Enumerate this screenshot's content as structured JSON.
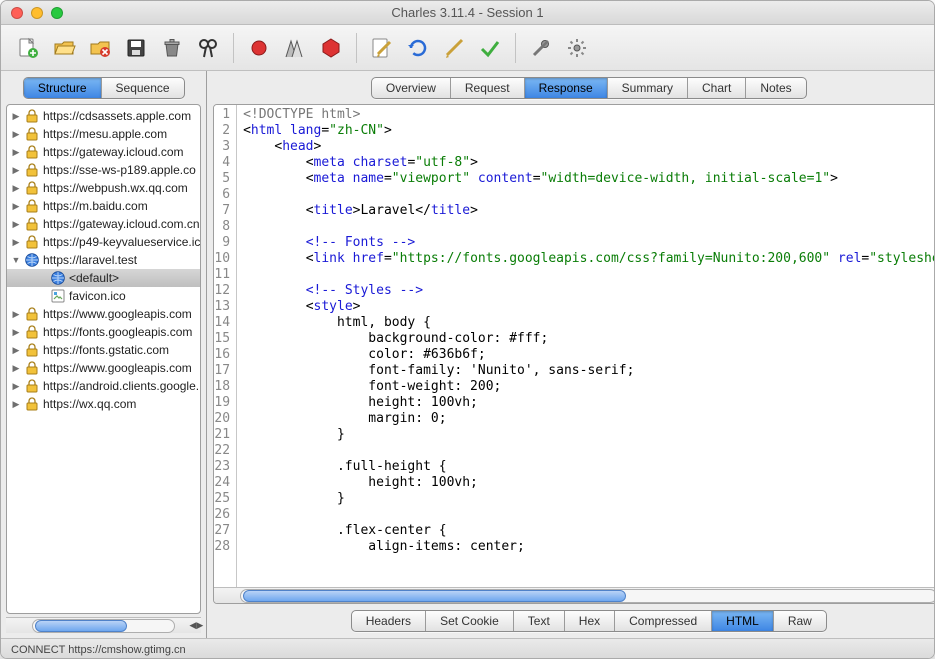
{
  "window": {
    "title": "Charles 3.11.4 - Session 1"
  },
  "left_tabs": {
    "structure": "Structure",
    "sequence": "Sequence",
    "active": "structure"
  },
  "tree": [
    {
      "expand": "closed",
      "icon": "lock",
      "label": "https://cdsassets.apple.com"
    },
    {
      "expand": "closed",
      "icon": "lock",
      "label": "https://mesu.apple.com"
    },
    {
      "expand": "closed",
      "icon": "lock",
      "label": "https://gateway.icloud.com"
    },
    {
      "expand": "closed",
      "icon": "lock",
      "label": "https://sse-ws-p189.apple.co"
    },
    {
      "expand": "closed",
      "icon": "lock",
      "label": "https://webpush.wx.qq.com"
    },
    {
      "expand": "closed",
      "icon": "lock",
      "label": "https://m.baidu.com"
    },
    {
      "expand": "closed",
      "icon": "lock",
      "label": "https://gateway.icloud.com.cn"
    },
    {
      "expand": "closed",
      "icon": "lock",
      "label": "https://p49-keyvalueservice.ic"
    },
    {
      "expand": "open",
      "icon": "globe",
      "label": "https://laravel.test",
      "children": [
        {
          "icon": "globe",
          "label": "<default>",
          "selected": true
        },
        {
          "icon": "file",
          "label": "favicon.ico"
        }
      ]
    },
    {
      "expand": "closed",
      "icon": "lock",
      "label": "https://www.googleapis.com"
    },
    {
      "expand": "closed",
      "icon": "lock",
      "label": "https://fonts.googleapis.com"
    },
    {
      "expand": "closed",
      "icon": "lock",
      "label": "https://fonts.gstatic.com"
    },
    {
      "expand": "closed",
      "icon": "lock",
      "label": "https://www.googleapis.com"
    },
    {
      "expand": "closed",
      "icon": "lock",
      "label": "https://android.clients.google."
    },
    {
      "expand": "closed",
      "icon": "lock",
      "label": "https://wx.qq.com"
    }
  ],
  "top_tabs": {
    "items": [
      "Overview",
      "Request",
      "Response",
      "Summary",
      "Chart",
      "Notes"
    ],
    "active": 2
  },
  "bottom_tabs": {
    "items": [
      "Headers",
      "Set Cookie",
      "Text",
      "Hex",
      "Compressed",
      "HTML",
      "Raw"
    ],
    "active": 5
  },
  "code": {
    "first_line": 1,
    "lines": [
      {
        "t": "doctype",
        "raw": "<!DOCTYPE html>"
      },
      {
        "t": "open",
        "tag": "html",
        "attrs": [
          [
            "lang",
            "zh-CN"
          ]
        ]
      },
      {
        "t": "open",
        "indent": 1,
        "tag": "head"
      },
      {
        "t": "selfclose",
        "indent": 2,
        "tag": "meta",
        "attrs": [
          [
            "charset",
            "utf-8"
          ]
        ]
      },
      {
        "t": "selfclose",
        "indent": 2,
        "tag": "meta",
        "attrs": [
          [
            "name",
            "viewport"
          ],
          [
            "content",
            "width=device-width, initial-scale=1"
          ]
        ]
      },
      {
        "t": "blank"
      },
      {
        "t": "inline",
        "indent": 2,
        "tag": "title",
        "text": "Laravel"
      },
      {
        "t": "blank"
      },
      {
        "t": "comment",
        "indent": 2,
        "text": "Fonts"
      },
      {
        "t": "selfclose",
        "indent": 2,
        "tag": "link",
        "attrs": [
          [
            "href",
            "https://fonts.googleapis.com/css?family=Nunito:200,600"
          ],
          [
            "rel",
            "styleshee"
          ]
        ]
      },
      {
        "t": "blank"
      },
      {
        "t": "comment",
        "indent": 2,
        "text": "Styles"
      },
      {
        "t": "open",
        "indent": 2,
        "tag": "style"
      },
      {
        "t": "css",
        "indent": 3,
        "raw": "html, body {"
      },
      {
        "t": "css",
        "indent": 4,
        "raw": "background-color: #fff;"
      },
      {
        "t": "css",
        "indent": 4,
        "raw": "color: #636b6f;"
      },
      {
        "t": "css",
        "indent": 4,
        "raw": "font-family: 'Nunito', sans-serif;"
      },
      {
        "t": "css",
        "indent": 4,
        "raw": "font-weight: 200;"
      },
      {
        "t": "css",
        "indent": 4,
        "raw": "height: 100vh;"
      },
      {
        "t": "css",
        "indent": 4,
        "raw": "margin: 0;"
      },
      {
        "t": "css",
        "indent": 3,
        "raw": "}"
      },
      {
        "t": "blank"
      },
      {
        "t": "css",
        "indent": 3,
        "raw": ".full-height {"
      },
      {
        "t": "css",
        "indent": 4,
        "raw": "height: 100vh;"
      },
      {
        "t": "css",
        "indent": 3,
        "raw": "}"
      },
      {
        "t": "blank"
      },
      {
        "t": "css",
        "indent": 3,
        "raw": ".flex-center {"
      },
      {
        "t": "css",
        "indent": 4,
        "raw": "align-items: center;"
      }
    ]
  },
  "status": "CONNECT https://cmshow.gtimg.cn"
}
